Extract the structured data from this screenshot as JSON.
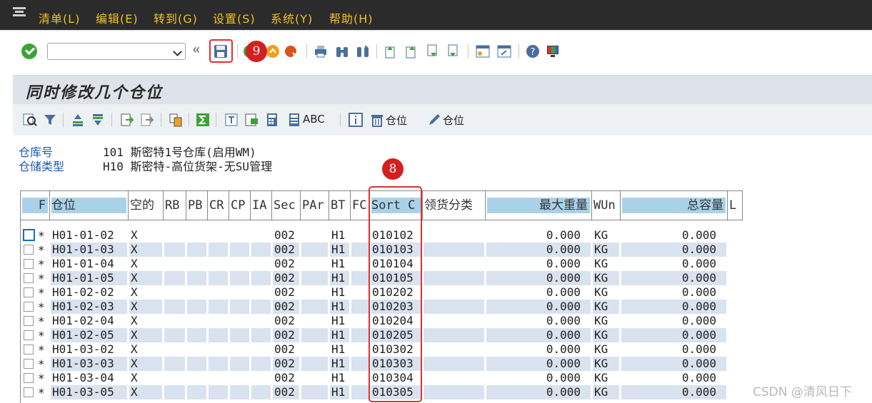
{
  "menu": {
    "items": [
      "清单(L)",
      "编辑(E)",
      "转到(G)",
      "设置(S)",
      "系统(Y)",
      "帮助(H)"
    ]
  },
  "toolbar": {
    "command_field_value": "",
    "expand_symbol": "«"
  },
  "callouts": {
    "save": "9",
    "sort": "8"
  },
  "page": {
    "title": "同时修改几个仓位"
  },
  "alv_toolbar": {
    "abc_label": "ABC",
    "delete_bin_label": "仓位",
    "edit_bin_label": "仓位"
  },
  "header": {
    "warehouse_label": "仓库号",
    "warehouse_value": "101 斯密特1号仓库(启用WM)",
    "storage_type_label": "仓储类型",
    "storage_type_value": "H10 斯密特-高位货架-无SU管理"
  },
  "table": {
    "columns": [
      "F",
      "仓位",
      "空的",
      "RB",
      "PB",
      "CR",
      "CP",
      "IA",
      "Sec",
      "PAr",
      "BT",
      "FC",
      "Sort C",
      "领货分类",
      "最大重量",
      "WUn",
      "总容量",
      "L"
    ],
    "rows": [
      {
        "bin": "H01-01-02",
        "empty": "X",
        "sec": "002",
        "bt": "H1",
        "sort": "010102",
        "weight": "0.000",
        "wun": "KG",
        "cap": "0.000"
      },
      {
        "bin": "H01-01-03",
        "empty": "X",
        "sec": "002",
        "bt": "H1",
        "sort": "010103",
        "weight": "0.000",
        "wun": "KG",
        "cap": "0.000"
      },
      {
        "bin": "H01-01-04",
        "empty": "X",
        "sec": "002",
        "bt": "H1",
        "sort": "010104",
        "weight": "0.000",
        "wun": "KG",
        "cap": "0.000"
      },
      {
        "bin": "H01-01-05",
        "empty": "X",
        "sec": "002",
        "bt": "H1",
        "sort": "010105",
        "weight": "0.000",
        "wun": "KG",
        "cap": "0.000"
      },
      {
        "bin": "H01-02-02",
        "empty": "X",
        "sec": "002",
        "bt": "H1",
        "sort": "010202",
        "weight": "0.000",
        "wun": "KG",
        "cap": "0.000"
      },
      {
        "bin": "H01-02-03",
        "empty": "X",
        "sec": "002",
        "bt": "H1",
        "sort": "010203",
        "weight": "0.000",
        "wun": "KG",
        "cap": "0.000"
      },
      {
        "bin": "H01-02-04",
        "empty": "X",
        "sec": "002",
        "bt": "H1",
        "sort": "010204",
        "weight": "0.000",
        "wun": "KG",
        "cap": "0.000"
      },
      {
        "bin": "H01-02-05",
        "empty": "X",
        "sec": "002",
        "bt": "H1",
        "sort": "010205",
        "weight": "0.000",
        "wun": "KG",
        "cap": "0.000"
      },
      {
        "bin": "H01-03-02",
        "empty": "X",
        "sec": "002",
        "bt": "H1",
        "sort": "010302",
        "weight": "0.000",
        "wun": "KG",
        "cap": "0.000"
      },
      {
        "bin": "H01-03-03",
        "empty": "X",
        "sec": "002",
        "bt": "H1",
        "sort": "010303",
        "weight": "0.000",
        "wun": "KG",
        "cap": "0.000"
      },
      {
        "bin": "H01-03-04",
        "empty": "X",
        "sec": "002",
        "bt": "H1",
        "sort": "010304",
        "weight": "0.000",
        "wun": "KG",
        "cap": "0.000"
      },
      {
        "bin": "H01-03-05",
        "empty": "X",
        "sec": "002",
        "bt": "H1",
        "sort": "010305",
        "weight": "0.000",
        "wun": "KG",
        "cap": "0.000"
      }
    ],
    "row_marker": "*"
  },
  "watermark": "CSDN @清风日下",
  "colors": {
    "menu_bg": "#2b2b2b",
    "menu_text": "#f0c020",
    "header_cell_bg": "#a9d2e9",
    "alt_row_bg": "#d9e2ef",
    "highlight_red": "#e03030"
  }
}
